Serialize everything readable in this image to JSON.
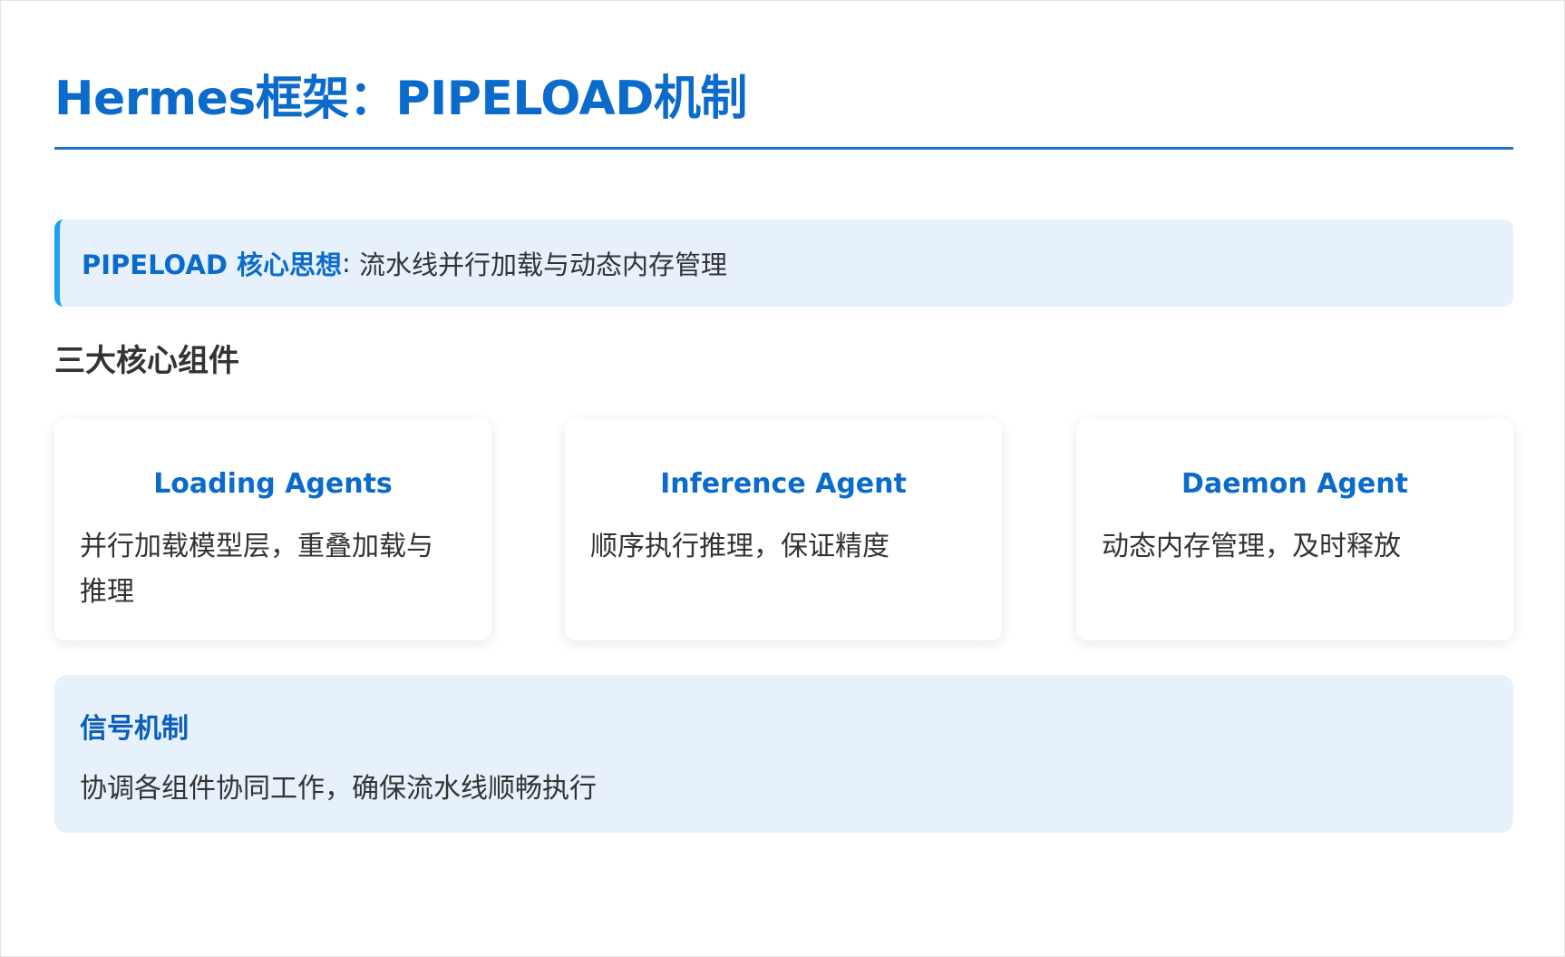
{
  "header": {
    "title": "Hermes框架：PIPELOAD机制"
  },
  "core_idea": {
    "label": "PIPELOAD 核心思想",
    "separator": ":",
    "text": "流水线并行加载与动态内存管理"
  },
  "components": {
    "heading": "三大核心组件",
    "cards": [
      {
        "title": "Loading Agents",
        "description": "并行加载模型层，重叠加载与推理"
      },
      {
        "title": "Inference Agent",
        "description": "顺序执行推理，保证精度"
      },
      {
        "title": "Daemon Agent",
        "description": "动态内存管理，及时释放"
      }
    ]
  },
  "signal": {
    "title": "信号机制",
    "description": "协调各组件协同工作，确保流水线顺畅执行"
  },
  "colors": {
    "accent": "#0b6bcb",
    "rule": "#1e72d0",
    "highlight_border": "#1aa3f0",
    "panel_background": "#e6f1fc",
    "body_text": "#333333"
  }
}
